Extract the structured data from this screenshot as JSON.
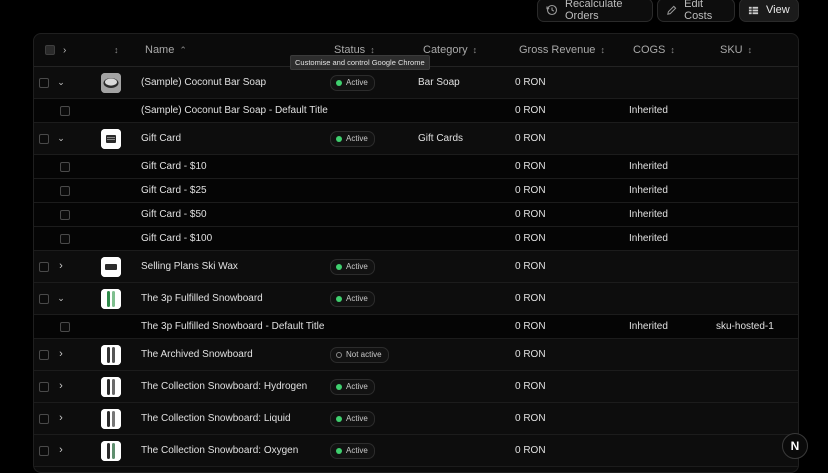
{
  "toolbar": {
    "recalculate": "Recalculate Orders",
    "edit_costs": "Edit Costs",
    "view": "View"
  },
  "columns": {
    "name": "Name",
    "status": "Status",
    "category": "Category",
    "gross_revenue": "Gross Revenue",
    "cogs": "COGS",
    "sku": "SKU"
  },
  "tooltip": "Customise and control Google Chrome",
  "colors": {
    "active": "#3fcf6e",
    "inactive": "#8a8a8a"
  },
  "rows": [
    {
      "name": "(Sample) Coconut Bar Soap",
      "status": "Active",
      "category": "Bar Soap",
      "revenue": "0 RON",
      "cogs": "",
      "sku": ""
    },
    {
      "name": "(Sample) Coconut Bar Soap - Default Title",
      "status": "",
      "category": "",
      "revenue": "0 RON",
      "cogs": "Inherited",
      "sku": ""
    },
    {
      "name": "Gift Card",
      "status": "Active",
      "category": "Gift Cards",
      "revenue": "0 RON",
      "cogs": "",
      "sku": ""
    },
    {
      "name": "Gift Card - $10",
      "status": "",
      "category": "",
      "revenue": "0 RON",
      "cogs": "Inherited",
      "sku": ""
    },
    {
      "name": "Gift Card - $25",
      "status": "",
      "category": "",
      "revenue": "0 RON",
      "cogs": "Inherited",
      "sku": ""
    },
    {
      "name": "Gift Card - $50",
      "status": "",
      "category": "",
      "revenue": "0 RON",
      "cogs": "Inherited",
      "sku": ""
    },
    {
      "name": "Gift Card - $100",
      "status": "",
      "category": "",
      "revenue": "0 RON",
      "cogs": "Inherited",
      "sku": ""
    },
    {
      "name": "Selling Plans Ski Wax",
      "status": "Active",
      "category": "",
      "revenue": "0 RON",
      "cogs": "",
      "sku": ""
    },
    {
      "name": "The 3p Fulfilled Snowboard",
      "status": "Active",
      "category": "",
      "revenue": "0 RON",
      "cogs": "",
      "sku": ""
    },
    {
      "name": "The 3p Fulfilled Snowboard - Default Title",
      "status": "",
      "category": "",
      "revenue": "0 RON",
      "cogs": "Inherited",
      "sku": "sku-hosted-1"
    },
    {
      "name": "The Archived Snowboard",
      "status": "Not active",
      "category": "",
      "revenue": "0 RON",
      "cogs": "",
      "sku": ""
    },
    {
      "name": "The Collection Snowboard: Hydrogen",
      "status": "Active",
      "category": "",
      "revenue": "0 RON",
      "cogs": "",
      "sku": ""
    },
    {
      "name": "The Collection Snowboard: Liquid",
      "status": "Active",
      "category": "",
      "revenue": "0 RON",
      "cogs": "",
      "sku": ""
    },
    {
      "name": "The Collection Snowboard: Oxygen",
      "status": "Active",
      "category": "",
      "revenue": "0 RON",
      "cogs": "",
      "sku": ""
    }
  ],
  "fab_label": "N"
}
